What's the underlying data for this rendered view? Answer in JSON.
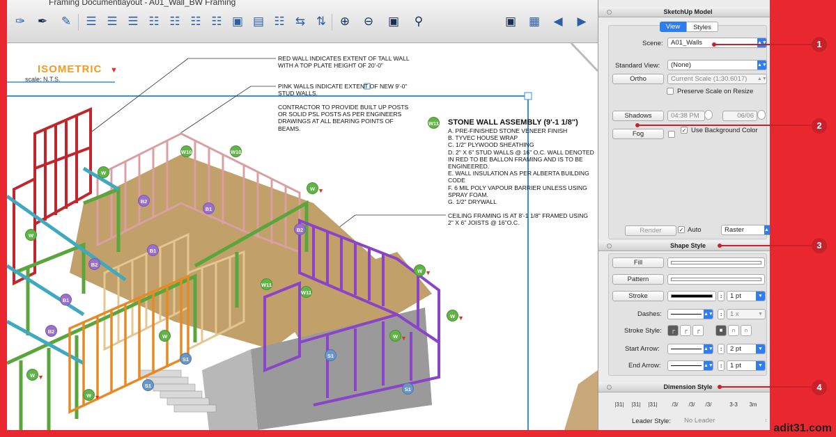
{
  "window": {
    "title": "Framing Documentlayout - A01_Wall_BW Framing"
  },
  "toolbar": {
    "icons": [
      "eyedropper-icon",
      "pen-tool-icon",
      "eraser-icon",
      "align-left-icon",
      "align-center-icon",
      "align-right-icon",
      "align-top-icon",
      "align-middle-icon",
      "align-bottom-icon",
      "distribute-horizontal-icon",
      "distribute-vertical-icon",
      "center-object-icon",
      "fit-page-icon",
      "flip-horizontal-icon",
      "flip-vertical-icon",
      "zoom-in-icon",
      "zoom-out-icon",
      "zoom-fit-icon",
      "zoom-find-icon",
      "presentation-icon",
      "add-page-icon",
      "previous-page-icon",
      "next-page-icon"
    ]
  },
  "drawing": {
    "title": "ISOMETRIC",
    "scale": "scale: N.T.S.",
    "note_red_wall": "RED WALL INDICATES EXTENT OF TALL WALL WITH A TOP PLATE HEIGHT OF 20'-0\"",
    "note_pink_wall": "PINK WALLS INDICATE EXTENT OF NEW 9'-0\" STUD WALLS.",
    "note_contractor": "CONTRACTOR TO PROVIDE BUILT UP POSTS OR SOLID PSL POSTS AS PER ENGINEERS DRAWINGS AT ALL BEARING POINTS OF BEAMS.",
    "stone_tag": "W11",
    "stone_title": "STONE WALL ASSEMBLY (9'-1 1/8\")",
    "stone_items": [
      "A. PRE-FINISHED STONE VENEER FINISH",
      "B. TYVEC HOUSE WRAP",
      "C. 1/2\" PLYWOOD SHEATHING",
      "D. 2\" X 6\" STUD WALLS @ 16\" O.C. WALL DENOTED IN RED TO BE BALLON FRAMING AND IS TO BE ENGINEERED.",
      "E. WALL INSULATION AS PER ALBERTA BUILDING CODE",
      "F. 6 MIL POLY VAPOUR BARRIER UNLESS USING SPRAY FOAM.",
      "G. 1/2\" DRYWALL"
    ],
    "note_ceiling": "CEILING FRAMING IS AT 8'-1 1/8\" FRAMED USING 2\" X 6\" JOISTS @ 16\"O.C.",
    "tags": {
      "w": "W",
      "w10": "W10",
      "w11": "W11",
      "b1": "B1",
      "b2": "B2",
      "s1": "S1"
    }
  },
  "panel": {
    "model_title": "SketchUp Model",
    "tab_view": "View",
    "tab_styles": "Styles",
    "scene_label": "Scene:",
    "scene_value": "A01_Walls",
    "standard_view_label": "Standard View:",
    "standard_view_value": "(None)",
    "ortho_label": "Ortho",
    "scale_value": "Current Scale (1:30.6017)",
    "preserve_scale_label": "Preserve Scale on Resize",
    "shadows_label": "Shadows",
    "shadow_time": "04:38 PM",
    "shadow_date": "06/06",
    "fog_label": "Fog",
    "use_bg_label": "Use Background Color",
    "render_label": "Render",
    "auto_label": "Auto",
    "render_mode": "Raster",
    "shape_style_title": "Shape Style",
    "fill_label": "Fill",
    "pattern_label": "Pattern",
    "stroke_label": "Stroke",
    "stroke_width": "1 pt",
    "dashes_label": "Dashes:",
    "dash_scale": "1 x",
    "stroke_style_label": "Stroke Style:",
    "start_arrow_label": "Start Arrow:",
    "start_arrow_size": "2 pt",
    "end_arrow_label": "End Arrow:",
    "end_arrow_size": "1 pt",
    "dimension_style_title": "Dimension Style",
    "dim_icons": [
      "|31|",
      "|31|",
      "|31|",
      "/3/",
      "/3/",
      "/3/",
      "3-3",
      "3m"
    ],
    "leader_style_label": "Leader Style:",
    "leader_style_value": "No Leader"
  },
  "callouts": [
    "1",
    "2",
    "3",
    "4"
  ],
  "watermark": "adit31.com",
  "colors": {
    "frame": "#e8272e",
    "accent_blue": "#2f7df3",
    "callout": "#c9202a",
    "wall_red": "#c0262b",
    "wall_green": "#5aa53c",
    "wall_teal": "#3fa9c0",
    "wall_orange": "#e58a24",
    "wall_purple": "#8a45c6",
    "wall_pink": "#d9a0a4",
    "floor": "#c2a06a"
  }
}
